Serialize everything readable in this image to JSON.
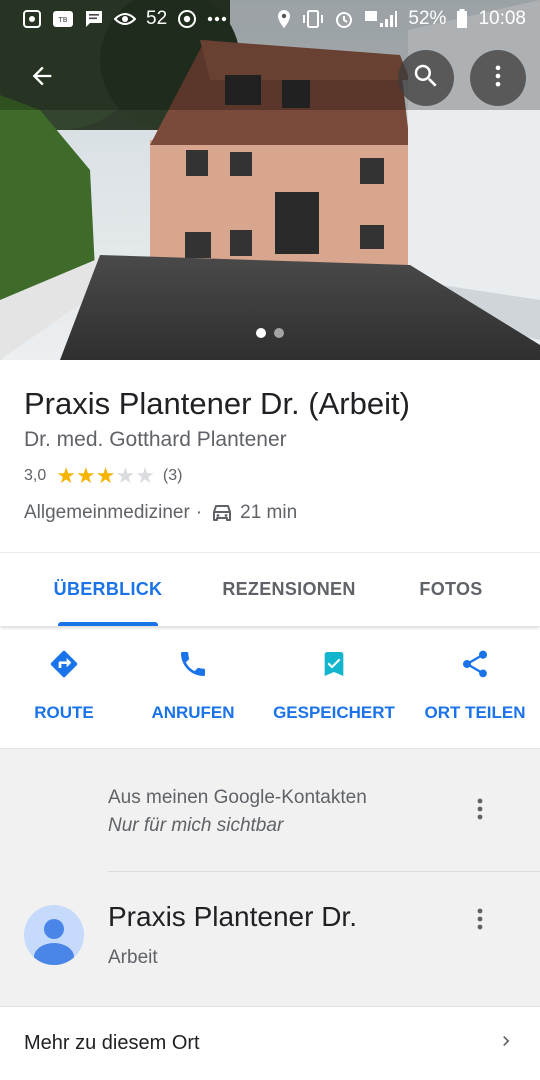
{
  "status_bar": {
    "notification_count": "52",
    "battery": "52%",
    "time": "10:08",
    "icons": [
      "toon-blast-icon",
      "app-icon",
      "message-icon",
      "eye-icon",
      "chrome-icon",
      "more-notifications-icon",
      "location-icon",
      "vibrate-icon",
      "alarm-icon",
      "hd-signal-icon",
      "battery-icon"
    ]
  },
  "hero": {
    "photo_count": 2,
    "active_photo": 0
  },
  "place": {
    "title": "Praxis Plantener Dr. (Arbeit)",
    "subtitle": "Dr. med. Gotthard Plantener",
    "rating": "3,0",
    "rating_value": 3,
    "rating_max": 5,
    "review_count": "(3)",
    "category": "Allgemeinmediziner",
    "separator": "·",
    "drive_time": "21 min"
  },
  "tabs": [
    {
      "label": "ÜBERBLICK",
      "active": true
    },
    {
      "label": "REZENSIONEN",
      "active": false
    },
    {
      "label": "FOTOS",
      "active": false
    }
  ],
  "actions": [
    {
      "label": "ROUTE",
      "icon": "directions-icon"
    },
    {
      "label": "ANRUFEN",
      "icon": "phone-icon"
    },
    {
      "label": "GESPEICHERT",
      "icon": "bookmark-check-icon"
    },
    {
      "label": "ORT TEILEN",
      "icon": "share-icon"
    }
  ],
  "contacts": {
    "header_title": "Aus meinen Google-Kontakten",
    "header_subtitle": "Nur für mich sichtbar",
    "contact_name": "Praxis Plantener Dr.",
    "contact_label": "Arbeit"
  },
  "more": {
    "label": "Mehr zu diesem Ort"
  },
  "colors": {
    "accent": "#1a73e8",
    "star": "#f4b400",
    "star_empty": "#dadce0",
    "contacts_bg": "#f1f1f1"
  }
}
